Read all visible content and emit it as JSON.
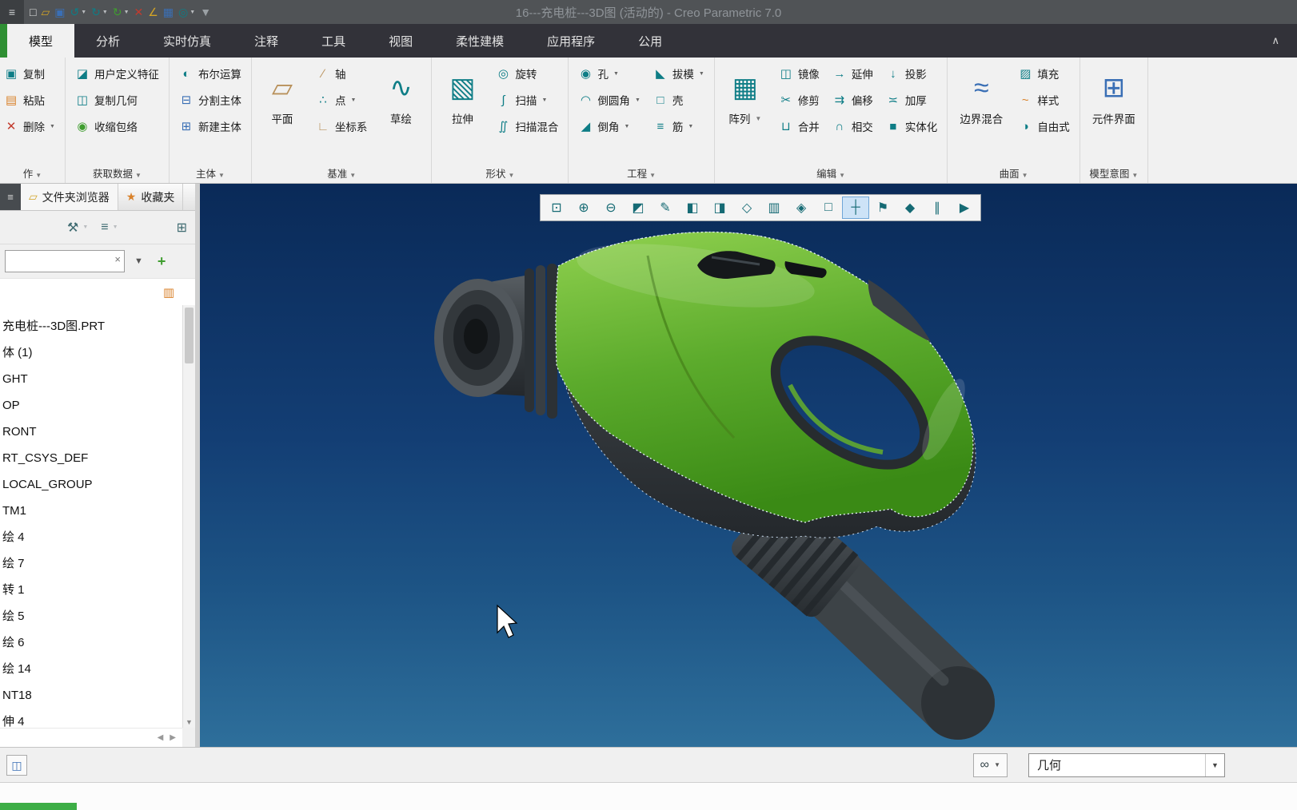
{
  "ui": {
    "arrow": "▼",
    "up": "▲",
    "down": "▼",
    "left": "◀",
    "right": "▶",
    "close_x": "×",
    "plus": "+",
    "chevron_up": "∧",
    "menu": "≡"
  },
  "titlebar": {
    "title": "16---充电桩---3D图 (活动的) - Creo Parametric 7.0",
    "quick_icons": [
      {
        "name": "new-file-icon",
        "glyph": "□",
        "color": "c-light",
        "arrow": ""
      },
      {
        "name": "open-file-icon",
        "glyph": "▱",
        "color": "c-yellow",
        "arrow": ""
      },
      {
        "name": "save-icon",
        "glyph": "▣",
        "color": "c-blue",
        "arrow": ""
      },
      {
        "name": "undo-icon",
        "glyph": "↺",
        "color": "c-teal",
        "arrow": "▼"
      },
      {
        "name": "redo-icon",
        "glyph": "↻",
        "color": "c-teal",
        "arrow": "▼"
      },
      {
        "name": "regenerate-icon",
        "glyph": "↻",
        "color": "c-green",
        "arrow": "▼"
      },
      {
        "name": "close-window-icon",
        "glyph": "✕",
        "color": "c-red",
        "arrow": ""
      },
      {
        "name": "measure-icon",
        "glyph": "∠",
        "color": "c-yellow",
        "arrow": ""
      },
      {
        "name": "capture-image-icon",
        "glyph": "▦",
        "color": "c-blue",
        "arrow": ""
      },
      {
        "name": "annotate-icon",
        "glyph": "◎",
        "color": "c-teal",
        "arrow": "▼"
      },
      {
        "name": "customize-toolbar-icon",
        "glyph": "▼",
        "color": "c-dim",
        "arrow": ""
      }
    ]
  },
  "tabs": [
    {
      "name": "tab-model",
      "label": "模型",
      "state": "active"
    },
    {
      "name": "tab-analysis",
      "label": "分析",
      "state": ""
    },
    {
      "name": "tab-live-simulation",
      "label": "实时仿真",
      "state": ""
    },
    {
      "name": "tab-annotate",
      "label": "注释",
      "state": ""
    },
    {
      "name": "tab-tools",
      "label": "工具",
      "state": ""
    },
    {
      "name": "tab-view",
      "label": "视图",
      "state": ""
    },
    {
      "name": "tab-flexible-modeling",
      "label": "柔性建模",
      "state": ""
    },
    {
      "name": "tab-applications",
      "label": "应用程序",
      "state": ""
    },
    {
      "name": "tab-common",
      "label": "公用",
      "state": ""
    }
  ],
  "ribbon": {
    "operations": {
      "label": "作",
      "buttons": [
        {
          "name": "copy-button",
          "label": "复制",
          "glyph": "▣",
          "color": "c-teal",
          "arrow": ""
        },
        {
          "name": "paste-button",
          "label": "粘贴",
          "glyph": "▤",
          "color": "c-orange",
          "arrow": ""
        },
        {
          "name": "delete-button",
          "label": "删除",
          "glyph": "✕",
          "color": "c-red",
          "arrow": "▼"
        }
      ]
    },
    "get_data": {
      "label": "获取数据",
      "buttons": [
        {
          "name": "udf-button",
          "label": "用户定义特征",
          "glyph": "◪",
          "color": "c-teal",
          "arrow": ""
        },
        {
          "name": "copy-geometry-button",
          "label": "复制几何",
          "glyph": "◫",
          "color": "c-teal",
          "arrow": ""
        },
        {
          "name": "shrinkwrap-button",
          "label": "收缩包络",
          "glyph": "◉",
          "color": "c-green",
          "arrow": ""
        }
      ]
    },
    "body": {
      "label": "主体",
      "buttons": [
        {
          "name": "boolean-operations-button",
          "label": "布尔运算",
          "glyph": "◐",
          "color": "c-teal",
          "arrow": ""
        },
        {
          "name": "split-body-button",
          "label": "分割主体",
          "glyph": "⊟",
          "color": "c-blue",
          "arrow": ""
        },
        {
          "name": "new-body-button",
          "label": "新建主体",
          "glyph": "⊞",
          "color": "c-blue",
          "arrow": ""
        }
      ]
    },
    "datum": {
      "label": "基准",
      "plane": {
        "label": "平面",
        "glyph": "▱"
      },
      "sketch": {
        "label": "草绘",
        "glyph": "∿"
      },
      "buttons": [
        {
          "name": "axis-button",
          "label": "轴",
          "glyph": "∕",
          "color": "c-tan",
          "arrow": ""
        },
        {
          "name": "point-button",
          "label": "点",
          "glyph": "∴",
          "color": "c-teal",
          "arrow": "▼"
        },
        {
          "name": "csys-button",
          "label": "坐标系",
          "glyph": "∟",
          "color": "c-tan",
          "arrow": ""
        }
      ]
    },
    "shapes": {
      "label": "形状",
      "extrude": {
        "label": "拉伸",
        "glyph": "▧"
      },
      "buttons": [
        {
          "name": "revolve-button",
          "label": "旋转",
          "glyph": "◎",
          "color": "c-teal",
          "arrow": ""
        },
        {
          "name": "sweep-button",
          "label": "扫描",
          "glyph": "∫",
          "color": "c-teal",
          "arrow": "▼"
        },
        {
          "name": "swept-blend-button",
          "label": "扫描混合",
          "glyph": "∬",
          "color": "c-teal",
          "arrow": ""
        }
      ]
    },
    "engineering": {
      "label": "工程",
      "col1": [
        {
          "name": "hole-button",
          "label": "孔",
          "glyph": "◉",
          "color": "c-teal",
          "arrow": "▼"
        },
        {
          "name": "round-button",
          "label": "倒圆角",
          "glyph": "◠",
          "color": "c-teal",
          "arrow": "▼"
        },
        {
          "name": "chamfer-button",
          "label": "倒角",
          "glyph": "◢",
          "color": "c-teal",
          "arrow": "▼"
        }
      ],
      "col2": [
        {
          "name": "draft-button",
          "label": "拔模",
          "glyph": "◣",
          "color": "c-teal",
          "arrow": "▼"
        },
        {
          "name": "shell-button",
          "label": "壳",
          "glyph": "□",
          "color": "c-teal",
          "arrow": ""
        },
        {
          "name": "rib-button",
          "label": "筋",
          "glyph": "≡",
          "color": "c-teal",
          "arrow": "▼"
        }
      ]
    },
    "editing": {
      "label": "编辑",
      "pattern": {
        "label": "阵列",
        "glyph": "▦"
      },
      "col1": [
        {
          "name": "mirror-button",
          "label": "镜像",
          "glyph": "◫",
          "color": "c-teal",
          "arrow": ""
        },
        {
          "name": "trim-button",
          "label": "修剪",
          "glyph": "✂",
          "color": "c-teal",
          "arrow": ""
        },
        {
          "name": "merge-button",
          "label": "合并",
          "glyph": "⊔",
          "color": "c-teal",
          "arrow": ""
        }
      ],
      "col2": [
        {
          "name": "extend-button",
          "label": "延伸",
          "glyph": "→",
          "color": "c-teal",
          "arrow": ""
        },
        {
          "name": "offset-button",
          "label": "偏移",
          "glyph": "⇉",
          "color": "c-teal",
          "arrow": ""
        },
        {
          "name": "intersect-button",
          "label": "相交",
          "glyph": "∩",
          "color": "c-teal",
          "arrow": ""
        }
      ],
      "col3": [
        {
          "name": "project-button",
          "label": "投影",
          "glyph": "↓",
          "color": "c-teal",
          "arrow": ""
        },
        {
          "name": "thicken-button",
          "label": "加厚",
          "glyph": "≍",
          "color": "c-teal",
          "arrow": ""
        },
        {
          "name": "solidify-button",
          "label": "实体化",
          "glyph": "■",
          "color": "c-teal",
          "arrow": ""
        }
      ]
    },
    "surfaces": {
      "label": "曲面",
      "boundary_blend": {
        "label": "边界混合",
        "glyph": "≈"
      },
      "buttons": [
        {
          "name": "fill-button",
          "label": "填充",
          "glyph": "▨",
          "color": "c-teal",
          "arrow": ""
        },
        {
          "name": "style-button",
          "label": "样式",
          "glyph": "~",
          "color": "c-orange",
          "arrow": ""
        },
        {
          "name": "freestyle-button",
          "label": "自由式",
          "glyph": "◑",
          "color": "c-teal",
          "arrow": ""
        }
      ]
    },
    "model_intent": {
      "label": "模型意图",
      "component_interface": {
        "label": "元件界面",
        "glyph": "⊞"
      }
    }
  },
  "navigator": {
    "tabs": [
      {
        "name": "folder-browser-tab",
        "label": "文件夹浏览器",
        "glyph": "▱"
      },
      {
        "name": "favorites-tab",
        "label": "收藏夹",
        "glyph": "★"
      }
    ],
    "toolbar": [
      {
        "name": "tree-settings-button",
        "glyph": "⚒",
        "arrow": "▼"
      },
      {
        "name": "tree-display-button",
        "glyph": "≡",
        "arrow": "▼"
      },
      {
        "name": "tree-layout-button",
        "glyph": "⊞",
        "arrow": ""
      }
    ],
    "filter_glyph": "▥",
    "tree": [
      "充电桩---3D图.PRT",
      "体 (1)",
      "GHT",
      "OP",
      "RONT",
      "RT_CSYS_DEF",
      "LOCAL_GROUP",
      "TM1",
      "绘 4",
      "绘 7",
      "转 1",
      "绘 5",
      "绘 6",
      "绘 14",
      "NT18",
      "伸 4"
    ]
  },
  "viewbar": {
    "icons": [
      {
        "name": "zoom-box-icon",
        "glyph": "⊡",
        "state": ""
      },
      {
        "name": "zoom-in-icon",
        "glyph": "⊕",
        "state": ""
      },
      {
        "name": "zoom-out-icon",
        "glyph": "⊖",
        "state": ""
      },
      {
        "name": "refit-icon",
        "glyph": "◩",
        "state": ""
      },
      {
        "name": "repaint-icon",
        "glyph": "✎",
        "state": ""
      },
      {
        "name": "section-icon",
        "glyph": "◧",
        "state": ""
      },
      {
        "name": "shade-icon",
        "glyph": "◨",
        "state": ""
      },
      {
        "name": "transparency-icon",
        "glyph": "◇",
        "state": ""
      },
      {
        "name": "saved-orientations-icon",
        "glyph": "▥",
        "state": ""
      },
      {
        "name": "view-manager-icon",
        "glyph": "◈",
        "state": ""
      },
      {
        "name": "display-style-icon",
        "glyph": "□",
        "state": ""
      },
      {
        "name": "datum-display-icon",
        "glyph": "┼",
        "state": "pressed"
      },
      {
        "name": "annotation-display-icon",
        "glyph": "⚑",
        "state": ""
      },
      {
        "name": "spin-center-icon",
        "glyph": "◆",
        "state": ""
      },
      {
        "name": "pause-icon",
        "glyph": "∥",
        "state": ""
      },
      {
        "name": "collector-icon",
        "glyph": "▶",
        "state": ""
      }
    ]
  },
  "statusbar": {
    "filter_label": "几何",
    "search_glyph": "∞",
    "tree_glyph": "◫"
  },
  "colors": {
    "accent_green": "#3dae46",
    "model_green": "#5cab2c",
    "viewport_top": "#0a2a58",
    "viewport_bottom": "#2e6f9b"
  }
}
